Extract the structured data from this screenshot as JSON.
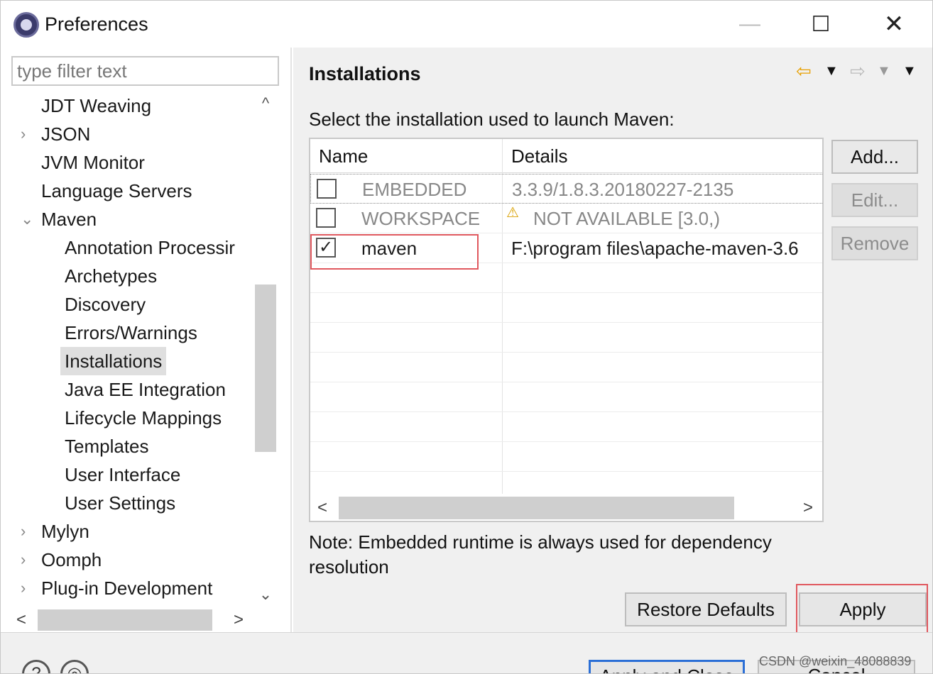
{
  "window": {
    "title": "Preferences",
    "min_glyph": "—",
    "max_glyph": "☐",
    "close_glyph": "✕"
  },
  "left": {
    "filter_placeholder": "type filter text",
    "tree": [
      {
        "label": "JDT Weaving",
        "level": 0,
        "twisty": ""
      },
      {
        "label": "JSON",
        "level": 0,
        "twisty": "›"
      },
      {
        "label": "JVM Monitor",
        "level": 0,
        "twisty": ""
      },
      {
        "label": "Language Servers",
        "level": 0,
        "twisty": ""
      },
      {
        "label": "Maven",
        "level": 0,
        "twisty": "⌄"
      },
      {
        "label": "Annotation Processir",
        "level": 1,
        "twisty": ""
      },
      {
        "label": "Archetypes",
        "level": 1,
        "twisty": ""
      },
      {
        "label": "Discovery",
        "level": 1,
        "twisty": ""
      },
      {
        "label": "Errors/Warnings",
        "level": 1,
        "twisty": ""
      },
      {
        "label": "Installations",
        "level": 1,
        "twisty": "",
        "selected": true
      },
      {
        "label": "Java EE Integration",
        "level": 1,
        "twisty": ""
      },
      {
        "label": "Lifecycle Mappings",
        "level": 1,
        "twisty": ""
      },
      {
        "label": "Templates",
        "level": 1,
        "twisty": ""
      },
      {
        "label": "User Interface",
        "level": 1,
        "twisty": ""
      },
      {
        "label": "User Settings",
        "level": 1,
        "twisty": ""
      },
      {
        "label": "Mylyn",
        "level": 0,
        "twisty": "›"
      },
      {
        "label": "Oomph",
        "level": 0,
        "twisty": "›"
      },
      {
        "label": "Plug-in Development",
        "level": 0,
        "twisty": "›"
      }
    ],
    "scroll_up": "^",
    "scroll_down": "⌄",
    "scroll_left": "<",
    "scroll_right": ">"
  },
  "main": {
    "title": "Installations",
    "description": "Select the installation used to launch Maven:",
    "table": {
      "columns": [
        "Name",
        "Details"
      ],
      "rows": [
        {
          "checked": false,
          "name": "EMBEDDED",
          "details": "3.3.9/1.8.3.20180227-2135",
          "muted": true,
          "warning": false
        },
        {
          "checked": false,
          "name": "WORKSPACE",
          "details": "NOT AVAILABLE [3.0,)",
          "muted": true,
          "warning": true
        },
        {
          "checked": true,
          "name": "maven",
          "details": "F:\\program files\\apache-maven-3.6",
          "muted": false,
          "warning": false
        }
      ]
    },
    "buttons": {
      "add": "Add...",
      "edit": "Edit...",
      "remove": "Remove"
    },
    "note": "Note: Embedded runtime is always used for dependency resolution",
    "restore_defaults": "Restore Defaults",
    "apply": "Apply"
  },
  "footer": {
    "help_glyph": "?",
    "import_glyph": "◎",
    "apply_and_close": "Apply and Close",
    "cancel": "Cancel",
    "watermark": "CSDN @weixin_48088839"
  },
  "colors": {
    "highlight_red": "#e0585e",
    "primary_blue": "#2b6fd6",
    "nav_back": "#e8a000"
  }
}
